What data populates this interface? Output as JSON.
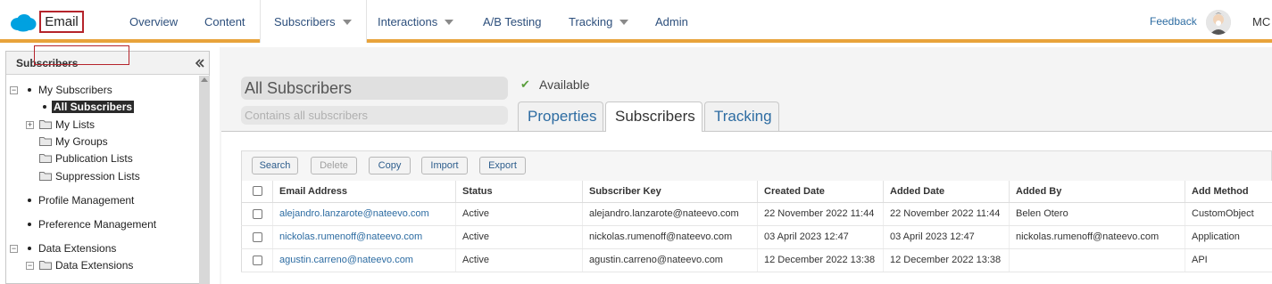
{
  "app": {
    "name": "Email",
    "brand_color": "#00a1e0",
    "accent_color": "#e8a33b"
  },
  "nav": {
    "items": [
      {
        "label": "Overview",
        "has_dropdown": false
      },
      {
        "label": "Content",
        "has_dropdown": false
      },
      {
        "label": "Subscribers",
        "has_dropdown": true,
        "active": true
      },
      {
        "label": "Interactions",
        "has_dropdown": true
      },
      {
        "label": "A/B Testing",
        "has_dropdown": false
      },
      {
        "label": "Tracking",
        "has_dropdown": true
      },
      {
        "label": "Admin",
        "has_dropdown": false
      }
    ],
    "feedback": "Feedback",
    "user_initials": "MC"
  },
  "sidebar": {
    "title": "Subscribers",
    "tree": {
      "my_subscribers": "My Subscribers",
      "all_subscribers": "All Subscribers",
      "my_lists": "My Lists",
      "my_groups": "My Groups",
      "publication_lists": "Publication Lists",
      "suppression_lists": "Suppression Lists",
      "profile_management": "Profile Management",
      "preference_management": "Preference Management",
      "data_extensions": "Data Extensions",
      "data_extensions_folder": "Data Extensions"
    }
  },
  "detail": {
    "name": "All Subscribers",
    "description_placeholder": "Contains all subscribers",
    "status": "Available",
    "tabs": [
      "Properties",
      "Subscribers",
      "Tracking"
    ],
    "active_tab": "Subscribers"
  },
  "toolbar": {
    "search": "Search",
    "delete": "Delete",
    "copy": "Copy",
    "import": "Import",
    "export": "Export"
  },
  "grid": {
    "columns": [
      "Email Address",
      "Status",
      "Subscriber Key",
      "Created Date",
      "Added Date",
      "Added By",
      "Add Method"
    ],
    "rows": [
      [
        "alejandro.lanzarote@nateevo.com",
        "Active",
        "alejandro.lanzarote@nateevo.com",
        "22 November 2022 11:44",
        "22 November 2022 11:44",
        "Belen Otero",
        "CustomObject"
      ],
      [
        "nickolas.rumenoff@nateevo.com",
        "Active",
        "nickolas.rumenoff@nateevo.com",
        "03 April 2023 12:47",
        "03 April 2023 12:47",
        "nickolas.rumenoff@nateevo.com",
        "Application"
      ],
      [
        "agustin.carreno@nateevo.com",
        "Active",
        "agustin.carreno@nateevo.com",
        "12 December 2022 13:38",
        "12 December 2022 13:38",
        "",
        "API"
      ]
    ]
  }
}
